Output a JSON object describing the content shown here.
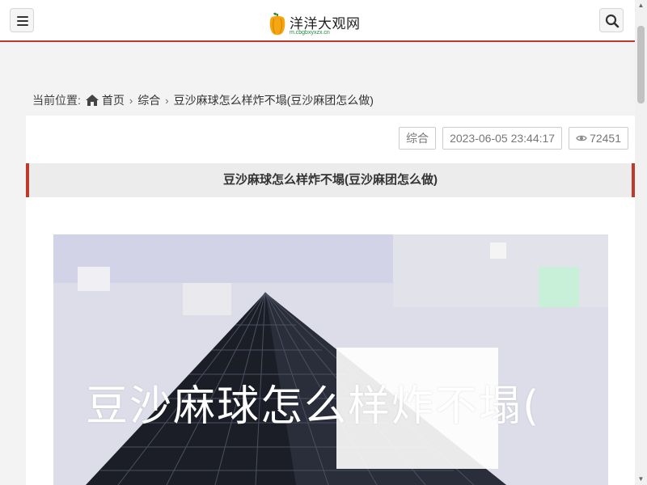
{
  "header": {
    "logo_title": "洋洋大观网",
    "logo_subtitle": "m.cbgbxyxzx.cn",
    "menu_icon": "menu-icon",
    "search_icon": "search-icon"
  },
  "breadcrumb": {
    "prefix": "当前位置:",
    "items": [
      "首页",
      "综合",
      "豆沙麻球怎么样炸不塌(豆沙麻团怎么做)"
    ]
  },
  "article": {
    "category": "综合",
    "datetime": "2023-06-05 23:44:17",
    "views": "72451",
    "title": "豆沙麻球怎么样炸不塌(豆沙麻团怎么做)",
    "hero_text": "豆沙麻球怎么样炸不塌("
  },
  "colors": {
    "accent": "#c0392b",
    "logo_sub": "#1e8a3e"
  }
}
